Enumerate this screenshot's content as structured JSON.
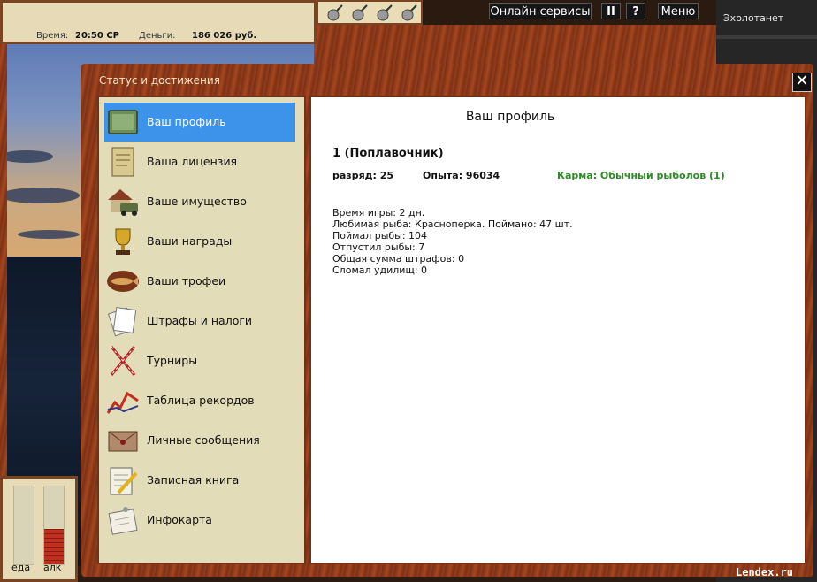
{
  "topbar": {
    "time_label": "Время:",
    "time_value": "20:50 СР",
    "money_label": "Деньги:",
    "money_value": "186 026 руб.",
    "online_services": "Онлайн сервисы",
    "pause": "II",
    "help": "?",
    "menu": "Меню",
    "echo_sounder": "Эхолотанет"
  },
  "dialog": {
    "title": "Статус и достижения",
    "close": "✕",
    "menu": [
      {
        "label": "Ваш профиль",
        "icon": "notebook-icon",
        "active": true
      },
      {
        "label": "Ваша лицензия",
        "icon": "license-icon",
        "active": false
      },
      {
        "label": "Ваше имущество",
        "icon": "house-car-icon",
        "active": false
      },
      {
        "label": "Ваши награды",
        "icon": "trophy-cup-icon",
        "active": false
      },
      {
        "label": "Ваши трофеи",
        "icon": "fish-plaque-icon",
        "active": false
      },
      {
        "label": "Штрафы и налоги",
        "icon": "papers-icon",
        "active": false
      },
      {
        "label": "Турниры",
        "icon": "crossed-flags-icon",
        "active": false
      },
      {
        "label": "Таблица рекордов",
        "icon": "chart-line-icon",
        "active": false
      },
      {
        "label": "Личные сообщения",
        "icon": "envelope-icon",
        "active": false
      },
      {
        "label": "Записная книга",
        "icon": "notepad-pencil-icon",
        "active": false
      },
      {
        "label": "Инфокарта",
        "icon": "infocard-icon",
        "active": false
      }
    ]
  },
  "profile": {
    "title": "Ваш профиль",
    "rank_title": "1 (Поплавочник)",
    "grade": "разряд: 25",
    "experience": "Опыта: 96034",
    "karma": "Карма: Обычный рыболов (1)",
    "details": [
      "Время игры: 2 дн.",
      "Любимая рыба: Красноперка. Поймано: 47 шт.",
      "Поймал рыбы: 104",
      "Отпустил рыбы: 7",
      "Общая сумма штрафов: 0",
      "Сломал удилищ: 0"
    ]
  },
  "meters": {
    "food_label": "еда",
    "alcohol_label": "алк",
    "food_level": 0.0,
    "alcohol_level": 0.45,
    "food_color": "#cfc9a6",
    "alcohol_color": "#c0301e"
  },
  "watermark": "Lendex.ru"
}
